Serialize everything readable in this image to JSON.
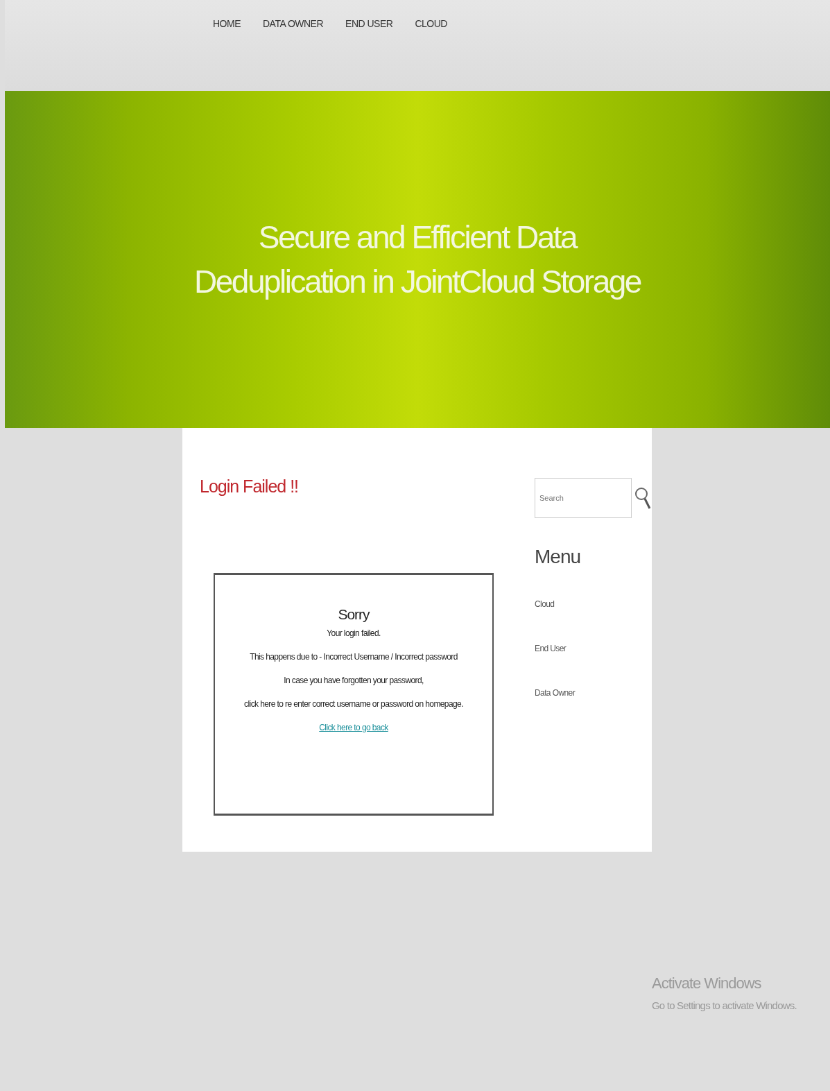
{
  "nav": [
    {
      "label": "HOME"
    },
    {
      "label": "DATA OWNER"
    },
    {
      "label": "END USER"
    },
    {
      "label": "CLOUD"
    }
  ],
  "banner": {
    "title": "Secure and Efficient Data Deduplication in JointCloud Storage"
  },
  "main": {
    "heading": "Login Failed !!",
    "message": {
      "title": "Sorry",
      "lines": [
        "Your login failed.",
        "This happens due to - Incorrect Username / Incorrect password",
        "In case you have forgotten your password,",
        "click here to re enter correct username or password on homepage."
      ],
      "link": "Click here to go back"
    }
  },
  "sidebar": {
    "search": {
      "placeholder": "Search"
    },
    "menu_title": "Menu",
    "items": [
      {
        "label": "Cloud"
      },
      {
        "label": "End User"
      },
      {
        "label": "Data Owner"
      }
    ]
  },
  "os_notice": {
    "title": "Activate Windows",
    "subtitle": "Go to Settings to activate Windows."
  }
}
